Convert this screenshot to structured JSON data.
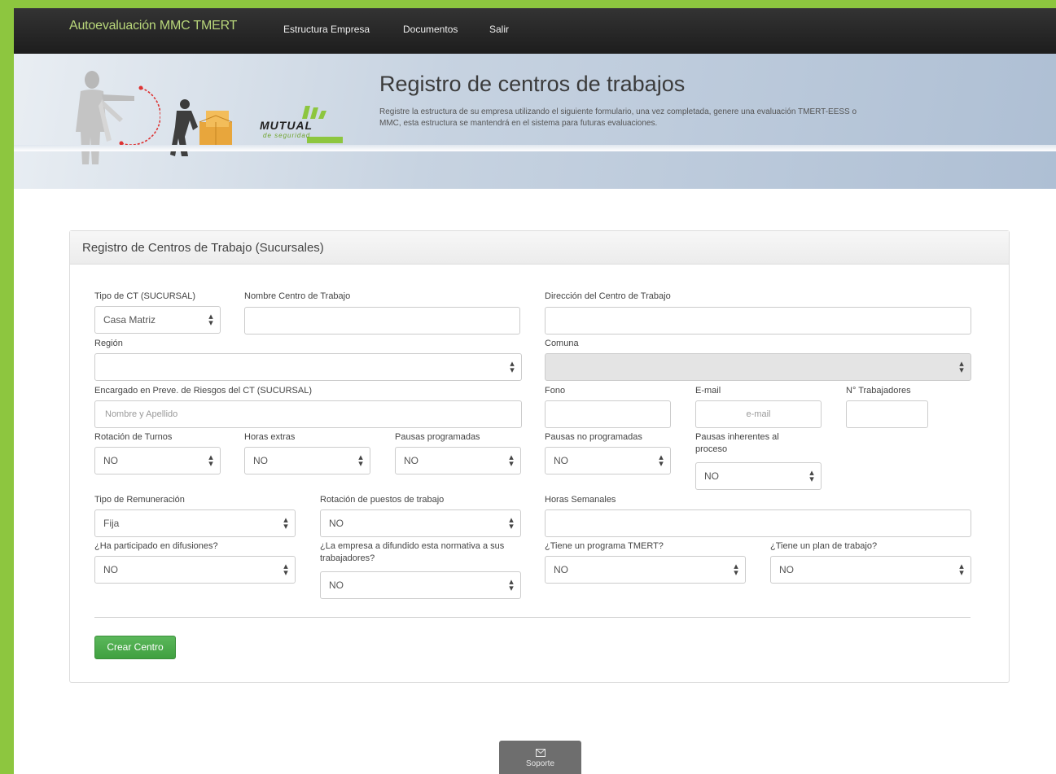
{
  "navbar": {
    "brand": "Autoevaluación MMC TMERT",
    "links": [
      "Estructura Empresa",
      "Documentos",
      "Salir"
    ]
  },
  "hero": {
    "title": "Registro de centros de trabajos",
    "description": "Registre la estructura de su empresa utilizando el siguiente formulario, una vez completada, genere una evaluación TMERT-EESS o MMC, esta estructura se mantendrá en el sistema para futuras evaluaciones.",
    "logo_text": "MUTUAL",
    "logo_subtext": "de seguridad"
  },
  "panel": {
    "title": "Registro de Centros de Trabajo (Sucursales)"
  },
  "form": {
    "tipo_ct": {
      "label": "Tipo de CT (SUCURSAL)",
      "value": "Casa Matriz"
    },
    "nombre_ct": {
      "label": "Nombre Centro de Trabajo",
      "value": ""
    },
    "direccion_ct": {
      "label": "Dirección del Centro de Trabajo",
      "value": ""
    },
    "region": {
      "label": "Región",
      "value": ""
    },
    "comuna": {
      "label": "Comuna",
      "value": ""
    },
    "encargado": {
      "label": "Encargado en Preve. de Riesgos del CT (SUCURSAL)",
      "placeholder": "Nombre y Apellido"
    },
    "fono": {
      "label": "Fono",
      "value": ""
    },
    "email": {
      "label": "E-mail",
      "placeholder": "e-mail"
    },
    "n_trabajadores": {
      "label": "N° Trabajadores",
      "value": ""
    },
    "rotacion_turnos": {
      "label": "Rotación de Turnos",
      "value": "NO"
    },
    "horas_extras": {
      "label": "Horas extras",
      "value": "NO"
    },
    "pausas_programadas": {
      "label": "Pausas programadas",
      "value": "NO"
    },
    "pausas_no_programadas": {
      "label": "Pausas no programadas",
      "value": "NO"
    },
    "pausas_inherentes": {
      "label": "Pausas inherentes al proceso",
      "value": "NO"
    },
    "tipo_remuneracion": {
      "label": "Tipo de Remuneración",
      "value": "Fija"
    },
    "rotacion_puestos": {
      "label": "Rotación de puestos de trabajo",
      "value": "NO"
    },
    "horas_semanales": {
      "label": "Horas Semanales",
      "value": ""
    },
    "difusiones": {
      "label": "¿Ha participado en difusiones?",
      "value": "NO"
    },
    "normativa": {
      "label": "¿La empresa a difundido esta normativa a sus trabajadores?",
      "value": "NO"
    },
    "programa_tmert": {
      "label": "¿Tiene un programa TMERT?",
      "value": "NO"
    },
    "plan_trabajo": {
      "label": "¿Tiene un plan de trabajo?",
      "value": "NO"
    },
    "submit_label": "Crear Centro"
  },
  "support": {
    "label": "Soporte"
  },
  "colors": {
    "brand_green": "#8dc63f",
    "button_green": "#4cae4c",
    "navbar": "#222222"
  }
}
